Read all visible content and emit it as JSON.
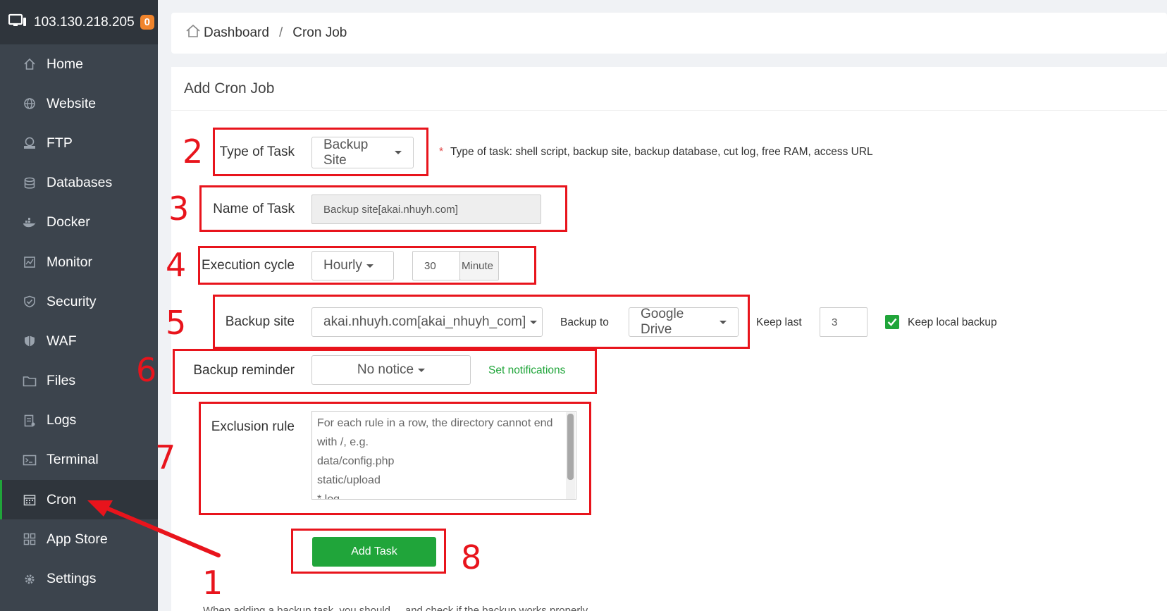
{
  "server": {
    "ip": "103.130.218.205",
    "badge_count": "0"
  },
  "sidebar": {
    "items": [
      {
        "label": "Home",
        "icon": "home-icon"
      },
      {
        "label": "Website",
        "icon": "globe-icon"
      },
      {
        "label": "FTP",
        "icon": "ftp-icon"
      },
      {
        "label": "Databases",
        "icon": "database-icon"
      },
      {
        "label": "Docker",
        "icon": "docker-icon"
      },
      {
        "label": "Monitor",
        "icon": "monitor-icon"
      },
      {
        "label": "Security",
        "icon": "shield-icon"
      },
      {
        "label": "WAF",
        "icon": "waf-icon"
      },
      {
        "label": "Files",
        "icon": "folder-icon"
      },
      {
        "label": "Logs",
        "icon": "logs-icon"
      },
      {
        "label": "Terminal",
        "icon": "terminal-icon"
      },
      {
        "label": "Cron",
        "icon": "calendar-icon",
        "active": true
      },
      {
        "label": "App Store",
        "icon": "grid-icon"
      },
      {
        "label": "Settings",
        "icon": "gear-icon"
      }
    ]
  },
  "breadcrumb": {
    "home": "Dashboard",
    "separator": "/",
    "current": "Cron Job"
  },
  "form": {
    "title": "Add Cron Job",
    "task_type": {
      "label": "Type of Task",
      "value": "Backup Site",
      "hint": "Type of task: shell script, backup site, backup database, cut log, free RAM, access URL",
      "hint_marker": "*"
    },
    "task_name": {
      "label": "Name of Task",
      "value": "Backup site[akai.nhuyh.com]"
    },
    "execution_cycle": {
      "label": "Execution cycle",
      "period": "Hourly",
      "minute_value": "30",
      "minute_unit": "Minute"
    },
    "backup": {
      "label": "Backup site",
      "site": "akai.nhuyh.com[akai_nhuyh_com]",
      "backup_to_label": "Backup to",
      "backup_to": "Google Drive",
      "keep_last_label": "Keep last",
      "keep_last": "3",
      "keep_local_label": "Keep local backup",
      "keep_local_checked": true
    },
    "reminder": {
      "label": "Backup reminder",
      "value": "No notice",
      "link": "Set notifications"
    },
    "exclusion": {
      "label": "Exclusion rule",
      "placeholder_lines": [
        "For each rule in a row, the directory cannot end",
        "with /, e.g.",
        "data/config.php",
        "static/upload",
        "*.log"
      ]
    },
    "submit": "Add Task",
    "footnote": "When adding a backup task, you should ... and check if the backup works properly"
  },
  "annotations": [
    "1",
    "2",
    "3",
    "4",
    "5",
    "6",
    "7",
    "8"
  ],
  "colors": {
    "sidebar_bg": "#3c444d",
    "sidebar_header": "#2f353c",
    "accent_green": "#20a53a",
    "annotation_red": "#e8141c",
    "badge_orange": "#f0842c"
  }
}
